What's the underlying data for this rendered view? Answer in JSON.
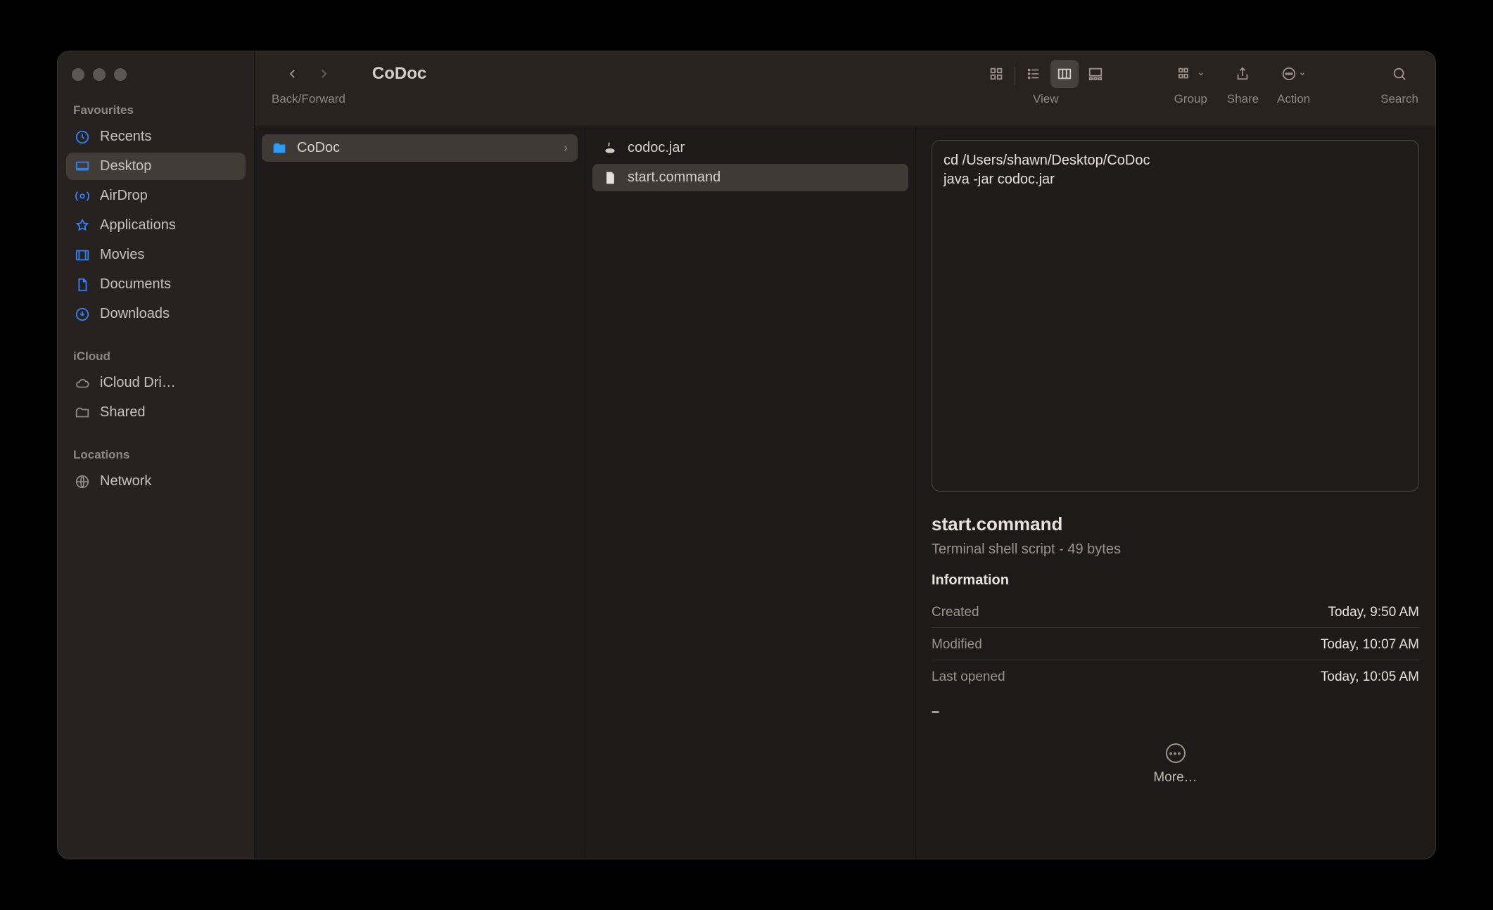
{
  "window": {
    "title": "CoDoc"
  },
  "toolbar": {
    "back_forward_label": "Back/Forward",
    "view_label": "View",
    "group_label": "Group",
    "share_label": "Share",
    "action_label": "Action",
    "search_label": "Search"
  },
  "sidebar": {
    "sections": {
      "favourites": "Favourites",
      "icloud": "iCloud",
      "locations": "Locations"
    },
    "favourites": [
      {
        "label": "Recents"
      },
      {
        "label": "Desktop"
      },
      {
        "label": "AirDrop"
      },
      {
        "label": "Applications"
      },
      {
        "label": "Movies"
      },
      {
        "label": "Documents"
      },
      {
        "label": "Downloads"
      }
    ],
    "icloud": [
      {
        "label": "iCloud Dri…"
      },
      {
        "label": "Shared"
      }
    ],
    "locations": [
      {
        "label": "Network"
      }
    ]
  },
  "columns": {
    "col1": [
      {
        "name": "CoDoc",
        "type": "folder"
      }
    ],
    "col2": [
      {
        "name": "codoc.jar",
        "type": "jar"
      },
      {
        "name": "start.command",
        "type": "file"
      }
    ]
  },
  "preview": {
    "content_line1": "cd /Users/shawn/Desktop/CoDoc",
    "content_line2": "java -jar codoc.jar",
    "filename": "start.command",
    "subtitle": "Terminal shell script - 49 bytes",
    "information_heading": "Information",
    "created_label": "Created",
    "created_value": "Today, 9:50 AM",
    "modified_label": "Modified",
    "modified_value": "Today, 10:07 AM",
    "opened_label": "Last opened",
    "opened_value": "Today, 10:05 AM",
    "dash": "–",
    "more_label": "More…"
  }
}
